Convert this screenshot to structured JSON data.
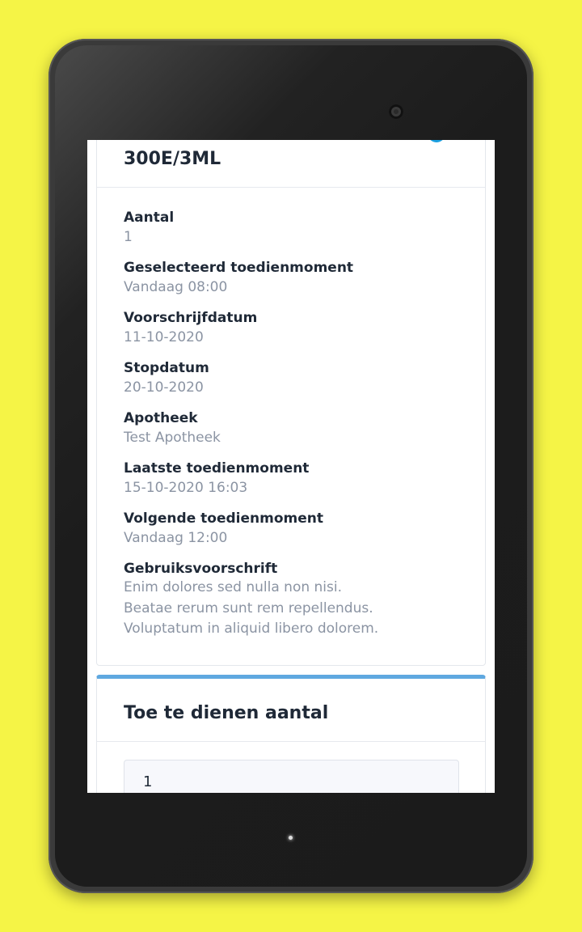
{
  "medication": {
    "title": "300E/3ML",
    "info_icon": "i",
    "fields": [
      {
        "label": "Aantal",
        "value": "1"
      },
      {
        "label": "Geselecteerd toedienmoment",
        "value": "Vandaag 08:00"
      },
      {
        "label": "Voorschrijfdatum",
        "value": "11-10-2020"
      },
      {
        "label": "Stopdatum",
        "value": "20-10-2020"
      },
      {
        "label": "Apotheek",
        "value": "Test Apotheek"
      },
      {
        "label": "Laatste toedienmoment",
        "value": "15-10-2020 16:03"
      },
      {
        "label": "Volgende toedienmoment",
        "value": "Vandaag 12:00"
      }
    ],
    "instructions": {
      "label": "Gebruiksvoorschrift",
      "lines": [
        "Enim dolores sed nulla non nisi.",
        "Beatae rerum sunt rem repellendus.",
        "Voluptatum in aliquid libero dolorem."
      ]
    }
  },
  "administer": {
    "title": "Toe te dienen aantal",
    "quantity_value": "1"
  },
  "colors": {
    "background": "#f5f446",
    "accent": "#5fa8e0",
    "info_icon": "#1a9fe0"
  },
  "icons": {
    "info": "info-icon"
  }
}
